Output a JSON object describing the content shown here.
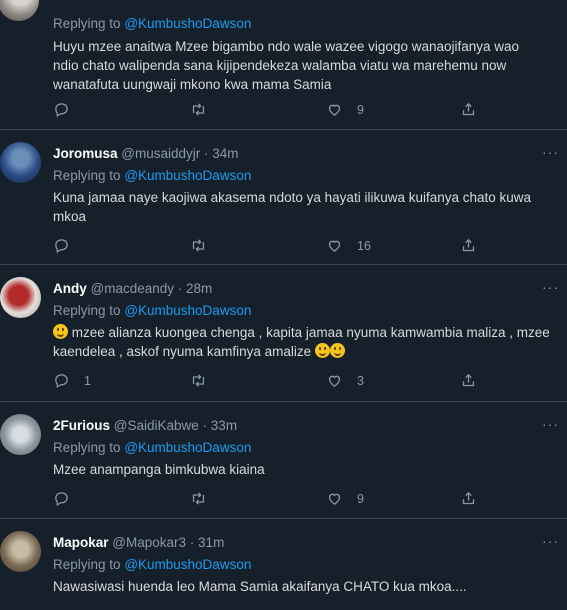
{
  "reply_prefix": "Replying to",
  "more_glyph": "···",
  "tweets": [
    {
      "name": "",
      "handle": "",
      "time": "",
      "mention": "@KumbushoDawson",
      "text_lines": [
        "Huyu mzee anaitwa Mzee bigambo ndo wale wazee vigogo wanaojifanya wao",
        "ndio chato walipenda sana kijipendekeza walamba viatu wa marehemu now",
        "wanatafuta uungwaji mkono kwa mama Samia"
      ],
      "replies": "",
      "retweets": "",
      "likes": "9"
    },
    {
      "name": "Joromusa",
      "handle": "@musaiddyjr",
      "time": "34m",
      "mention": "@KumbushoDawson",
      "text_lines": [
        "Kuna jamaa naye kaojiwa akasema ndoto ya hayati ilikuwa kuifanya chato kuwa",
        "mkoa"
      ],
      "replies": "",
      "retweets": "",
      "likes": "16"
    },
    {
      "name": "Andy",
      "handle": "@macdeandy",
      "time": "28m",
      "mention": "@KumbushoDawson",
      "text_lines": [
        " mzee alianza kuongea chenga , kapita jamaa nyuma kamwambia maliza , mzee",
        "kaendelea , askof nyuma kamfinya amalize "
      ],
      "replies": "1",
      "retweets": "",
      "likes": "3"
    },
    {
      "name": "2Furious",
      "handle": "@SaidiKabwe",
      "time": "33m",
      "mention": "@KumbushoDawson",
      "text_lines": [
        "Mzee anampanga bimkubwa kiaina"
      ],
      "replies": "",
      "retweets": "",
      "likes": "9"
    },
    {
      "name": "Mapokar",
      "handle": "@Mapokar3",
      "time": "31m",
      "mention": "@KumbushoDawson",
      "text_lines": [
        "Nawasiwasi huenda leo Mama Samia akaifanya CHATO kua mkoa...."
      ],
      "replies": "",
      "retweets": "",
      "likes": ""
    }
  ]
}
